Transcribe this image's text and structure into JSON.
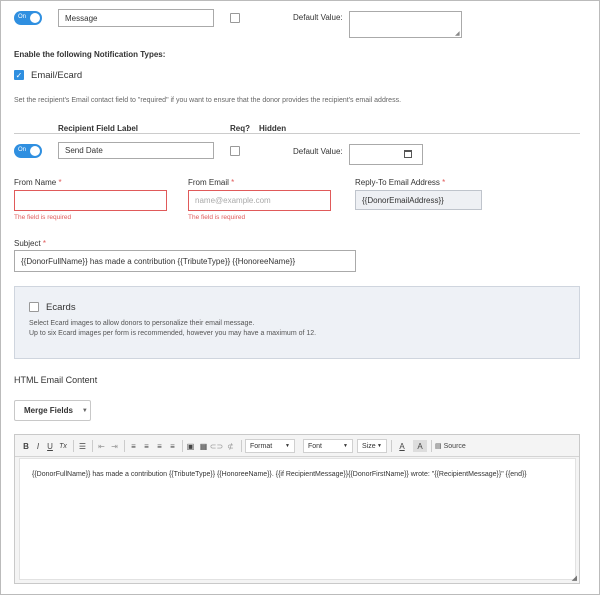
{
  "row1": {
    "toggle_label": "On",
    "field_label_value": "Message",
    "default_value_label": "Default Value:",
    "default_value": ""
  },
  "notification": {
    "heading": "Enable the following Notification Types:",
    "email_ecard_label": "Email/Ecard",
    "email_ecard_checked": true,
    "hint": "Set the recipient's Email contact field to \"required\" if you want to ensure that the donor provides the recipient's email address."
  },
  "recipient_table": {
    "col_field_label": "Recipient Field Label",
    "col_req": "Req?",
    "col_hidden": "Hidden",
    "row": {
      "toggle_label": "On",
      "field_label_value": "Send Date",
      "default_value_label": "Default Value:",
      "default_value": ""
    }
  },
  "email_fields": {
    "from_name": {
      "label": "From Name",
      "required_mark": "*",
      "value": "",
      "error": "The field is required"
    },
    "from_email": {
      "label": "From Email",
      "required_mark": "*",
      "placeholder": "name@example.com",
      "error": "The field is required"
    },
    "reply_to": {
      "label": "Reply-To Email Address",
      "required_mark": "*",
      "value": "{{DonorEmailAddress}}"
    },
    "subject": {
      "label": "Subject",
      "required_mark": "*",
      "value": "{{DonorFullName}} has made a contribution {{TributeType}} {{HonoreeName}}"
    }
  },
  "ecards": {
    "label": "Ecards",
    "desc_line1": "Select Ecard images to allow donors to personalize their email message.",
    "desc_line2": "Up to six Ecard images per form is recommended, however you may have a maximum of 12."
  },
  "html_email": {
    "heading": "HTML Email Content",
    "merge_fields_label": "Merge Fields"
  },
  "editor": {
    "toolbar": {
      "bold": "B",
      "italic": "I",
      "underline": "U",
      "strike": "Tx",
      "format_label": "Format",
      "font_label": "Font",
      "size_label": "Size",
      "text_color": "A",
      "bg_color": "A",
      "source_label": "Source"
    },
    "content": "{{DonorFullName}} has made a contribution {{TributeType}} {{HonoreeName}}. {{if RecipientMessage}}{{DonorFirstName}} wrote: \"{{RecipientMessage}}\" {{end}}"
  }
}
